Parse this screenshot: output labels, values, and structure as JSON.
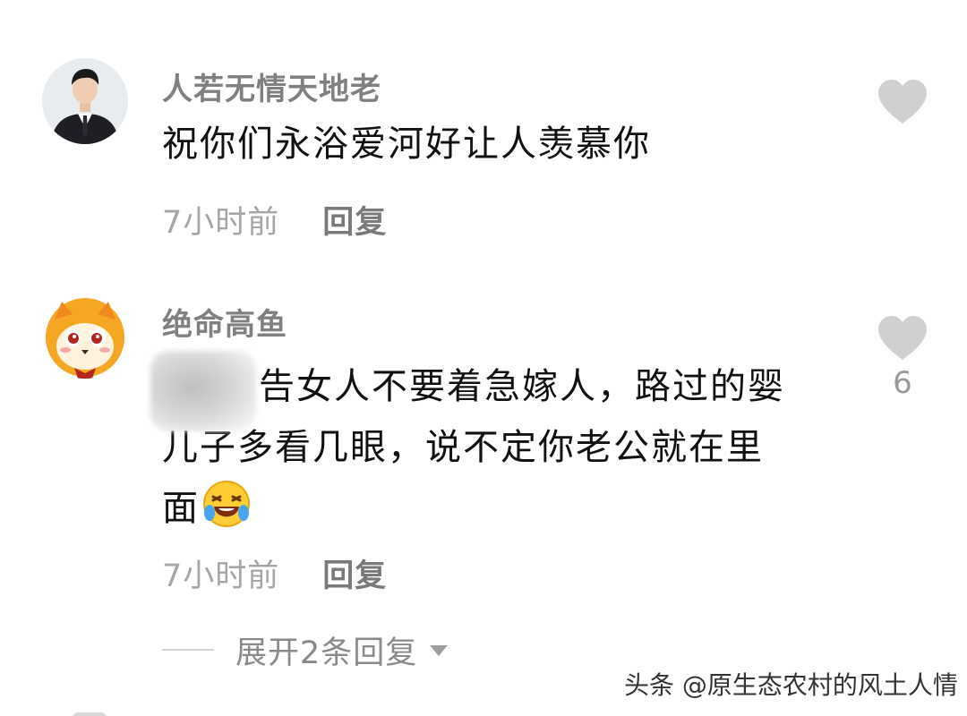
{
  "comments": [
    {
      "username": "人若无情天地老",
      "content_lines": [
        "祝你们永浴爱河好让人羡慕你"
      ],
      "time": "7小时前",
      "reply_label": "回复",
      "like_count": ""
    },
    {
      "username": "绝命高鱼",
      "content_lines": [
        "告女人不要着急嫁人，路过的婴",
        "儿子多看几眼，说不定你老公就在里",
        "面"
      ],
      "time": "7小时前",
      "reply_label": "回复",
      "like_count": "6",
      "emoji": "laughing-crying-emoji"
    }
  ],
  "expand_replies": {
    "label": "展开2条回复"
  },
  "watermark": "头条 @原生态农村的风土人情",
  "icons": {
    "like": "heart-icon",
    "expand": "triangle-down-icon"
  },
  "colors": {
    "username": "#808080",
    "content": "#111111",
    "meta": "#a6a6a6",
    "heart": "#d0d0d0"
  }
}
